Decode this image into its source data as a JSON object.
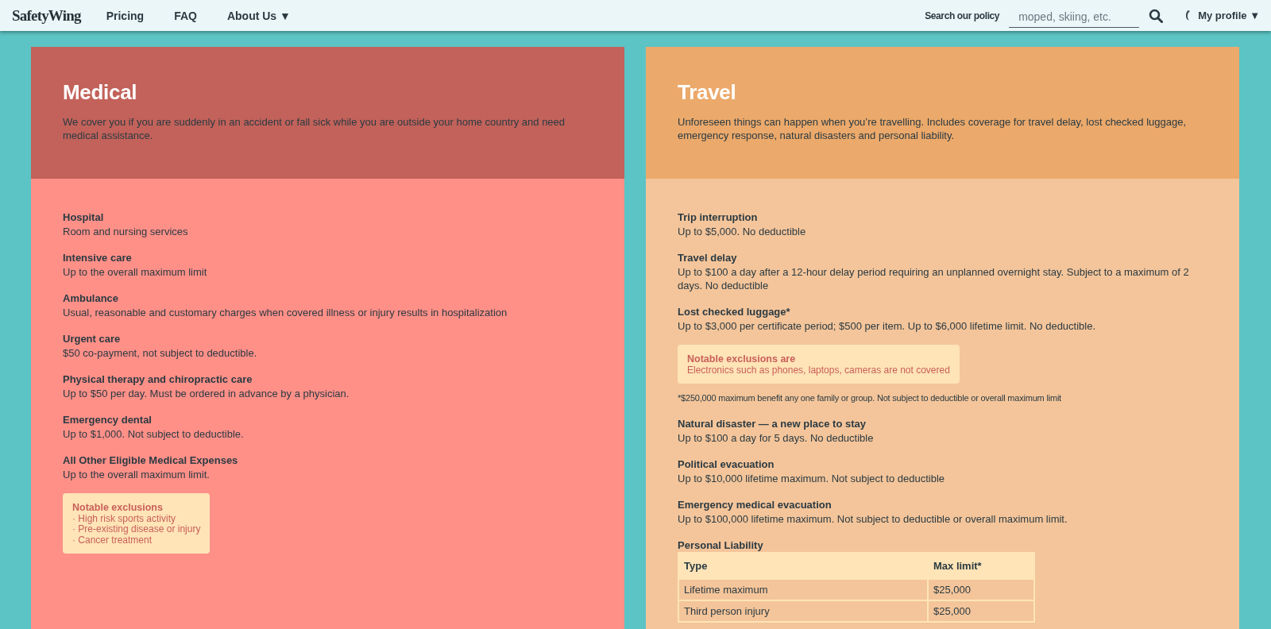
{
  "header": {
    "logo": "SafetyWing",
    "nav": [
      {
        "label": "Pricing",
        "kind": "link"
      },
      {
        "label": "FAQ",
        "kind": "link"
      },
      {
        "label": "About Us",
        "kind": "dropdown",
        "caret": "▼"
      }
    ],
    "search": {
      "label": "Search our policy",
      "placeholder": "moped, skiing, etc."
    },
    "profile": {
      "label": "My profile",
      "caret": "▼"
    }
  },
  "sections": [
    {
      "kind": "medical",
      "title": "Medical",
      "description": "We cover you if you are suddenly in an accident or fall sick while you are outside your home country and need medical assistance.",
      "items": [
        {
          "kind": "benefit",
          "title": "Hospital",
          "text": "Room and nursing services"
        },
        {
          "kind": "benefit",
          "title": "Intensive care",
          "text": "Up to the overall maximum limit"
        },
        {
          "kind": "benefit",
          "title": "Ambulance",
          "text": "Usual, reasonable and customary charges when covered illness or injury results in hospitalization"
        },
        {
          "kind": "benefit",
          "title": "Urgent care",
          "text": "$50 co-payment, not subject to deductible."
        },
        {
          "kind": "benefit",
          "title": "Physical therapy and chiropractic care",
          "text": "Up to $50 per day. Must be ordered in advance by a physician."
        },
        {
          "kind": "benefit",
          "title": "Emergency dental",
          "text": "Up to $1,000. Not subject to deductible."
        },
        {
          "kind": "benefit",
          "title": "All Other Eligible Medical Expenses",
          "text": "Up to the overall maximum limit."
        },
        {
          "kind": "exclusions",
          "title": "Notable exclusions",
          "lines": [
            "· High risk sports activity",
            "· Pre-existing disease or injury",
            "· Cancer treatment"
          ]
        }
      ]
    },
    {
      "kind": "travel",
      "title": "Travel",
      "description": "Unforeseen things can happen when you’re travelling. Includes coverage for travel delay, lost checked luggage, emergency response, natural disasters and personal liability.",
      "items": [
        {
          "kind": "benefit",
          "title": "Trip interruption",
          "text": "Up to $5,000. No deductible"
        },
        {
          "kind": "benefit",
          "title": "Travel delay",
          "text": "Up to $100 a day after a 12-hour delay period requiring an unplanned overnight stay. Subject to a maximum of 2 days. No deductible"
        },
        {
          "kind": "benefit",
          "title": "Lost checked luggage*",
          "text": "Up to $3,000 per certificate period; $500 per item. Up to $6,000 lifetime limit. No deductible."
        },
        {
          "kind": "exclusions",
          "title": "Notable exclusions are",
          "lines": [
            "Electronics such as phones, laptops, cameras are not covered"
          ]
        },
        {
          "kind": "note",
          "text": "*$250,000 maximum benefit any one family or group. Not subject to deductible or overall maximum limit"
        },
        {
          "kind": "benefit",
          "title": "Natural disaster — a new place to stay",
          "text": "Up to $100 a day for 5 days. No deductible"
        },
        {
          "kind": "benefit",
          "title": "Political evacuation",
          "text": "Up to $10,000 lifetime maximum. Not subject to deductible"
        },
        {
          "kind": "benefit",
          "title": "Emergency medical evacuation",
          "text": "Up to $100,000 lifetime maximum. Not subject to deductible or overall maximum limit."
        },
        {
          "kind": "table",
          "title": "Personal Liability",
          "columns": [
            "Type",
            "Max limit*"
          ],
          "rows": [
            [
              "Lifetime maximum",
              "$25,000"
            ],
            [
              "Third person injury",
              "$25,000"
            ]
          ]
        }
      ]
    }
  ]
}
